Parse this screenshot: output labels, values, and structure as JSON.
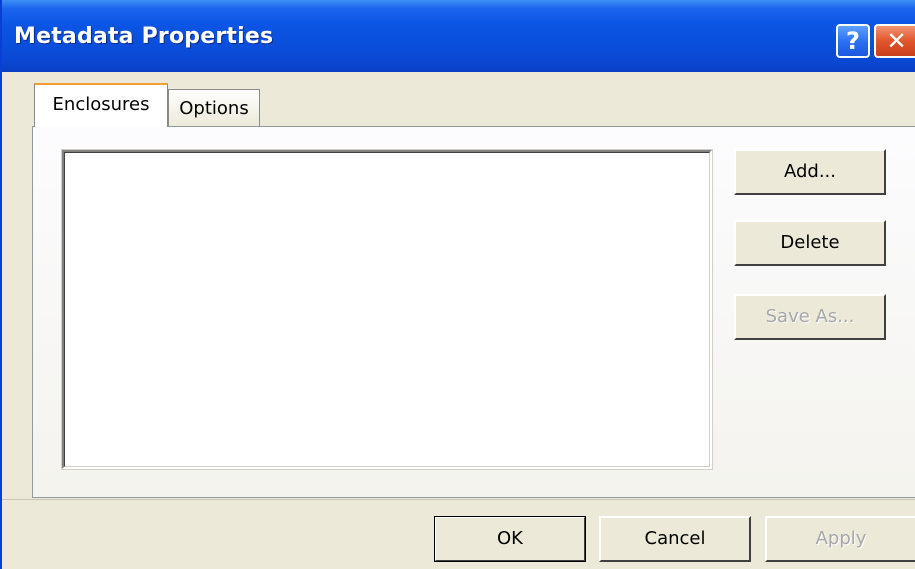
{
  "window": {
    "title": "Metadata Properties",
    "help_glyph": "?",
    "close_glyph": "✕"
  },
  "tabs": [
    {
      "label": "Enclosures",
      "selected": true
    },
    {
      "label": "Options",
      "selected": false
    }
  ],
  "enclosures": {
    "items": [],
    "buttons": {
      "add": "Add...",
      "delete": "Delete",
      "save_as": "Save As..."
    }
  },
  "footer": {
    "ok": "OK",
    "cancel": "Cancel",
    "apply": "Apply"
  },
  "colors": {
    "titlebar": "#0a4fdc",
    "dialog_bg": "#ece9d8",
    "close_button": "#e1552c",
    "help_button": "#2a6ef0",
    "selected_tab_accent": "#f0a030",
    "disabled_text": "#a7a6aa"
  }
}
